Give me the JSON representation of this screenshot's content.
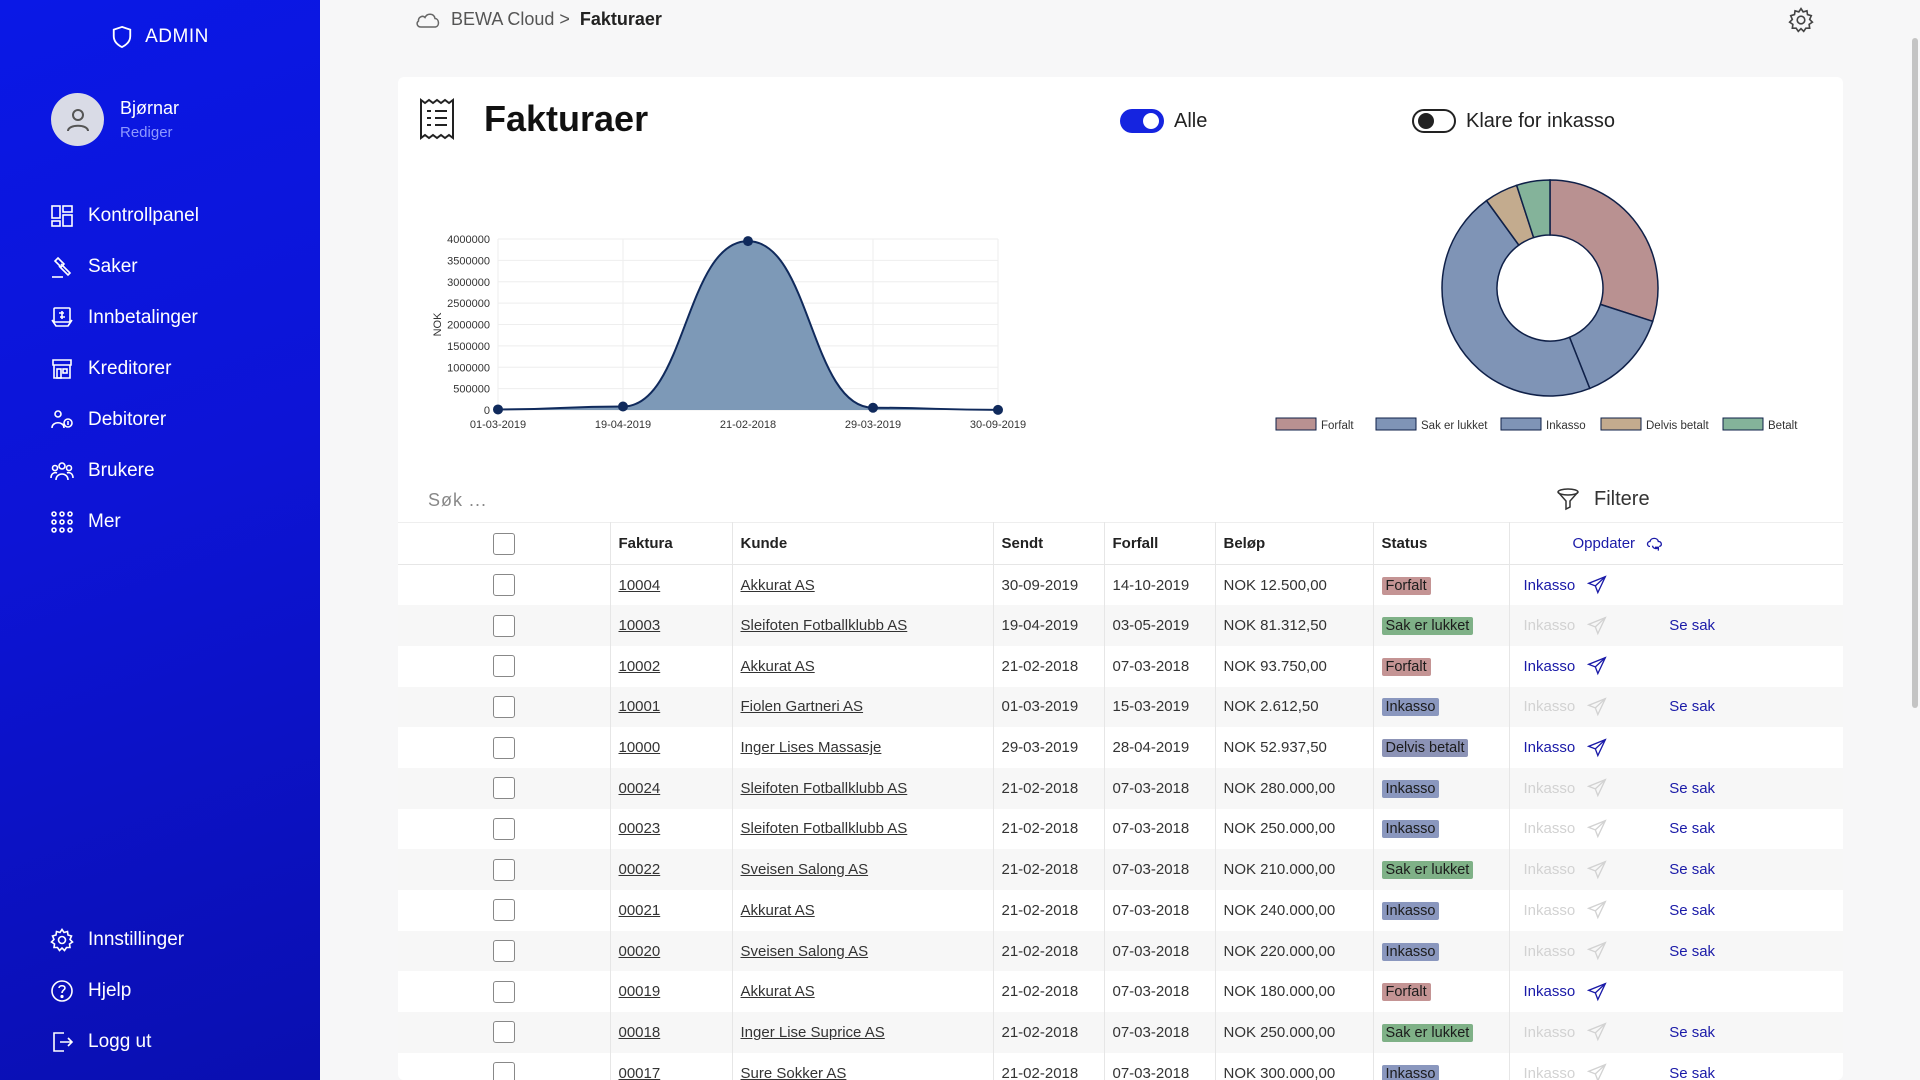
{
  "sidebar": {
    "admin_label": "ADMIN",
    "user": {
      "name": "Bjørnar",
      "edit": "Rediger"
    },
    "items": [
      {
        "label": "Kontrollpanel",
        "icon": "dashboard-icon"
      },
      {
        "label": "Saker",
        "icon": "gavel-icon"
      },
      {
        "label": "Innbetalinger",
        "icon": "payment-icon"
      },
      {
        "label": "Kreditorer",
        "icon": "store-icon"
      },
      {
        "label": "Debitorer",
        "icon": "people-money-icon"
      },
      {
        "label": "Brukere",
        "icon": "users-icon"
      },
      {
        "label": "Mer",
        "icon": "grid-icon"
      }
    ],
    "bottom_items": [
      {
        "label": "Innstillinger",
        "icon": "gear-icon"
      },
      {
        "label": "Hjelp",
        "icon": "help-icon"
      },
      {
        "label": "Logg ut",
        "icon": "logout-icon"
      }
    ]
  },
  "breadcrumb": {
    "root": "BEWA Cloud >",
    "current": "Fakturaer"
  },
  "page": {
    "title": "Fakturaer",
    "toggle_all": "Alle",
    "toggle_ready": "Klare for inkasso",
    "search_placeholder": "Søk ...",
    "filter_label": "Filtere"
  },
  "colors": {
    "sidebar": "#0d14d6",
    "accent": "#1524e0",
    "link": "#1a1aa8"
  },
  "chart_data": [
    {
      "type": "area",
      "x": [
        "01-03-2019",
        "19-04-2019",
        "21-02-2018",
        "29-03-2019",
        "30-09-2019"
      ],
      "values": [
        12500,
        81312.5,
        3950000,
        52937.5,
        2612.5
      ],
      "ylabel": "NOK",
      "ylim": [
        0,
        4000000
      ],
      "yticks": [
        "4000000",
        "3500000",
        "3000000",
        "2500000",
        "2000000",
        "1500000",
        "1000000",
        "500000",
        "0"
      ],
      "grid": true
    },
    {
      "type": "pie",
      "labels": [
        "Forfalt",
        "Sak er lukket",
        "Inkasso",
        "Delvis betalt",
        "Betalt"
      ],
      "values": [
        30,
        14,
        46,
        5,
        5
      ],
      "colors": [
        "#b99191",
        "#7f94b6",
        "#7f94b6",
        "#c3ab8e",
        "#84b39a"
      ],
      "legend": "bottom"
    }
  ],
  "table": {
    "headers": {
      "faktura": "Faktura",
      "kunde": "Kunde",
      "sendt": "Sendt",
      "forfall": "Forfall",
      "belop": "Beløp",
      "status": "Status",
      "oppdater": "Oppdater"
    },
    "inkasso_label": "Inkasso",
    "sesak_label": "Se sak",
    "rows": [
      {
        "faktura": "10004",
        "kunde": "Akkurat AS",
        "sendt": "30-09-2019",
        "forfall": "14-10-2019",
        "belop": "NOK 12.500,00",
        "status": "Forfalt",
        "active": true,
        "sesak": false
      },
      {
        "faktura": "10003",
        "kunde": "Sleifoten Fotballklubb AS",
        "sendt": "19-04-2019",
        "forfall": "03-05-2019",
        "belop": "NOK 81.312,50",
        "status": "Sak er lukket",
        "active": false,
        "sesak": true
      },
      {
        "faktura": "10002",
        "kunde": "Akkurat AS",
        "sendt": "21-02-2018",
        "forfall": "07-03-2018",
        "belop": "NOK 93.750,00",
        "status": "Forfalt",
        "active": true,
        "sesak": false
      },
      {
        "faktura": "10001",
        "kunde": "Fiolen Gartneri AS",
        "sendt": "01-03-2019",
        "forfall": "15-03-2019",
        "belop": "NOK 2.612,50",
        "status": "Inkasso",
        "active": false,
        "sesak": true
      },
      {
        "faktura": "10000",
        "kunde": "Inger Lises Massasje",
        "sendt": "29-03-2019",
        "forfall": "28-04-2019",
        "belop": "NOK 52.937,50",
        "status": "Delvis betalt",
        "active": true,
        "sesak": false
      },
      {
        "faktura": "00024",
        "kunde": "Sleifoten Fotballklubb AS",
        "sendt": "21-02-2018",
        "forfall": "07-03-2018",
        "belop": "NOK 280.000,00",
        "status": "Inkasso",
        "active": false,
        "sesak": true
      },
      {
        "faktura": "00023",
        "kunde": "Sleifoten Fotballklubb AS",
        "sendt": "21-02-2018",
        "forfall": "07-03-2018",
        "belop": "NOK 250.000,00",
        "status": "Inkasso",
        "active": false,
        "sesak": true
      },
      {
        "faktura": "00022",
        "kunde": "Sveisen Salong AS",
        "sendt": "21-02-2018",
        "forfall": "07-03-2018",
        "belop": "NOK 210.000,00",
        "status": "Sak er lukket",
        "active": false,
        "sesak": true
      },
      {
        "faktura": "00021",
        "kunde": "Akkurat AS",
        "sendt": "21-02-2018",
        "forfall": "07-03-2018",
        "belop": "NOK 240.000,00",
        "status": "Inkasso",
        "active": false,
        "sesak": true
      },
      {
        "faktura": "00020",
        "kunde": "Sveisen Salong AS",
        "sendt": "21-02-2018",
        "forfall": "07-03-2018",
        "belop": "NOK 220.000,00",
        "status": "Inkasso",
        "active": false,
        "sesak": true
      },
      {
        "faktura": "00019",
        "kunde": "Akkurat AS",
        "sendt": "21-02-2018",
        "forfall": "07-03-2018",
        "belop": "NOK 180.000,00",
        "status": "Forfalt",
        "active": true,
        "sesak": false
      },
      {
        "faktura": "00018",
        "kunde": "Inger Lise Suprice AS",
        "sendt": "21-02-2018",
        "forfall": "07-03-2018",
        "belop": "NOK 250.000,00",
        "status": "Sak er lukket",
        "active": false,
        "sesak": true
      },
      {
        "faktura": "00017",
        "kunde": "Sure Sokker AS",
        "sendt": "21-02-2018",
        "forfall": "07-03-2018",
        "belop": "NOK 300.000,00",
        "status": "Inkasso",
        "active": false,
        "sesak": true
      }
    ]
  }
}
